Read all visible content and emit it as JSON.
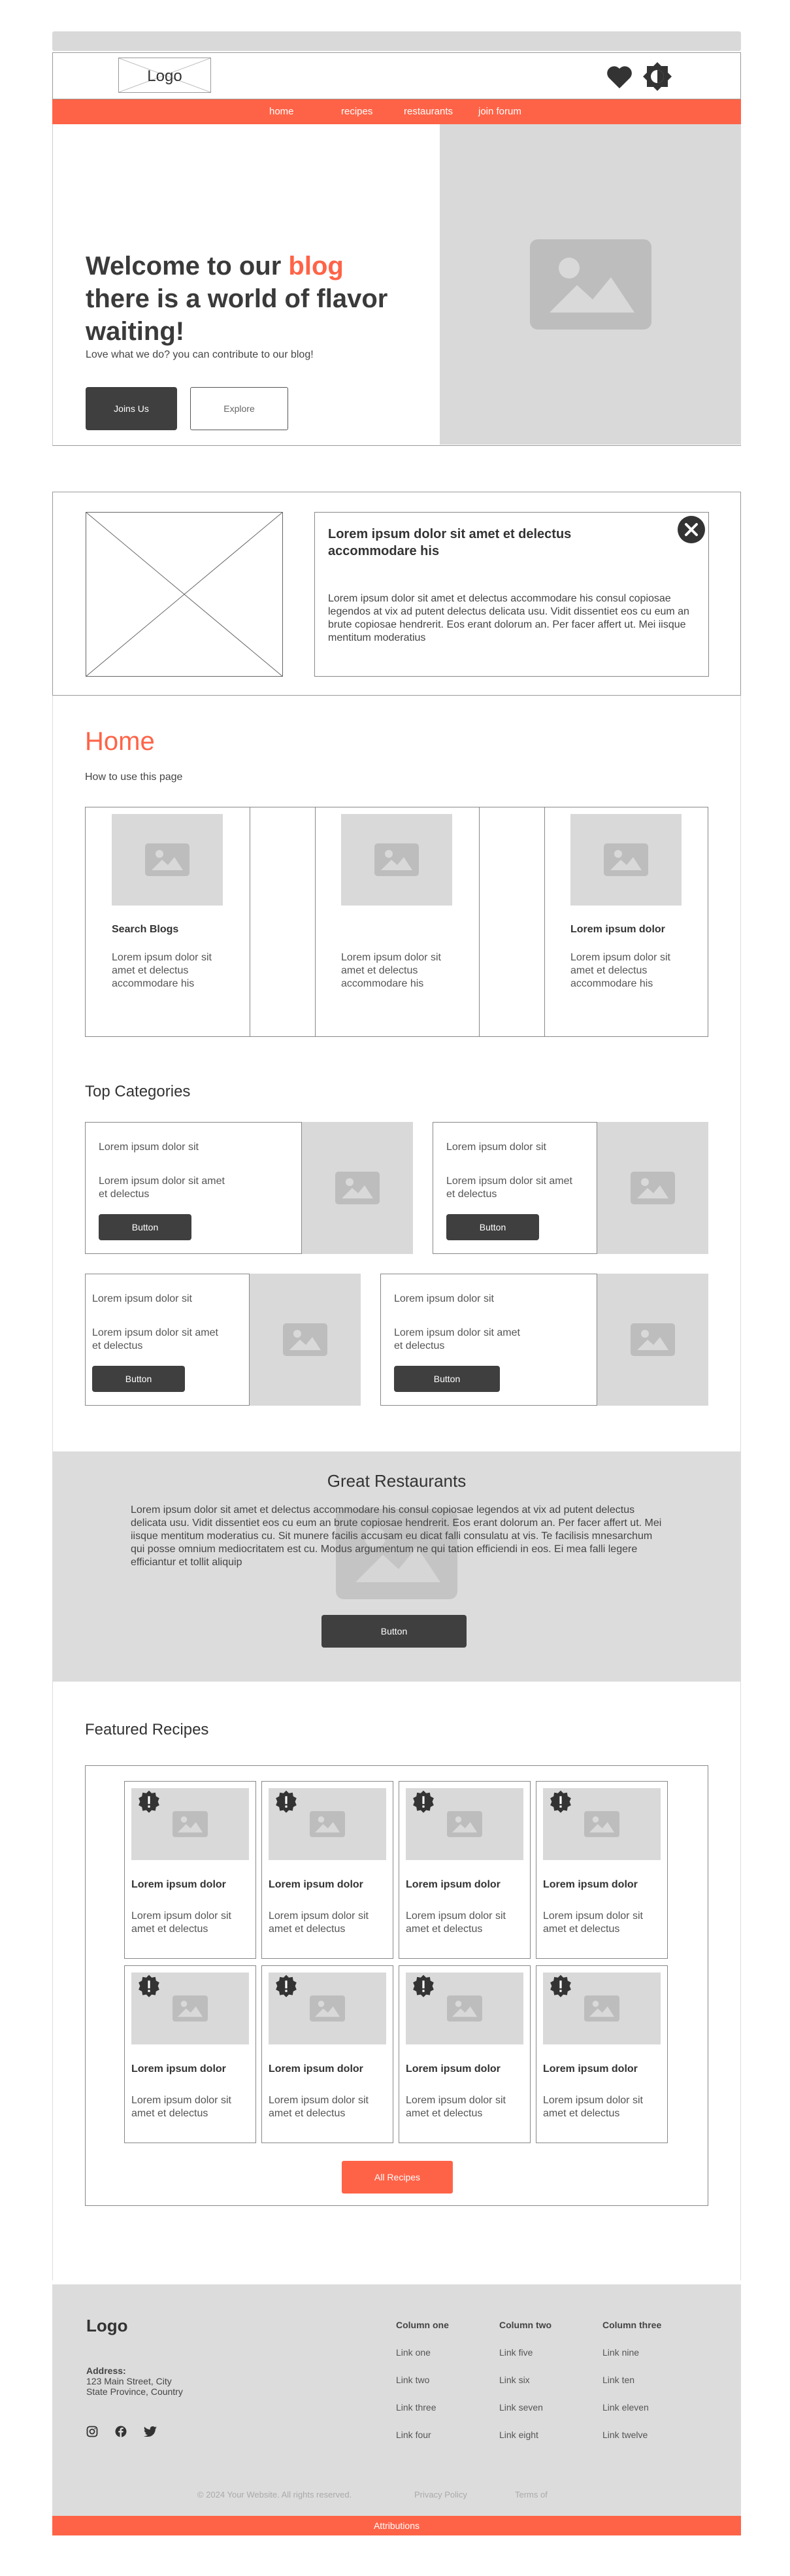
{
  "header": {
    "logo": "Logo",
    "icons": [
      "heart-icon",
      "brightness-icon"
    ]
  },
  "nav": {
    "items": [
      "home",
      "recipes",
      "restaurants",
      "join forum"
    ]
  },
  "hero": {
    "title_part1": "Welcome to our ",
    "title_accent": "blog",
    "title_part2": "there is a world of flavor waiting!",
    "subtitle": "Love what we do? you can contribute to our blog!",
    "primary_button": "Joins Us",
    "secondary_button": "Explore"
  },
  "notice": {
    "title": "Lorem ipsum dolor sit amet et delectus accommodare his",
    "text": "Lorem ipsum dolor sit amet et delectus accommodare his consul copiosae legendos at vix ad putent delectus delicata usu. Vidit dissentiet eos cu eum an brute copiosae hendrerit. Eos erant dolorum an. Per facer affert ut. Mei iisque mentitum moderatius"
  },
  "home": {
    "title": "Home",
    "subtitle": "How to use this page",
    "cards": [
      {
        "title": "Search Blogs",
        "text": "Lorem ipsum dolor sit amet et delectus accommodare his"
      },
      {
        "title": "",
        "text": "Lorem ipsum dolor sit amet et delectus accommodare his"
      },
      {
        "title": "Lorem ipsum dolor",
        "text": "Lorem ipsum dolor sit amet et delectus accommodare his"
      }
    ]
  },
  "categories": {
    "title": "Top Categories",
    "items": [
      {
        "title": "Lorem ipsum dolor sit",
        "text": "Lorem ipsum dolor sit amet et delectus",
        "button": "Button"
      },
      {
        "title": "Lorem ipsum dolor sit",
        "text": "Lorem ipsum dolor sit amet et delectus",
        "button": "Button"
      },
      {
        "title": "Lorem ipsum dolor sit",
        "text": "Lorem ipsum dolor sit amet et delectus",
        "button": "Button"
      },
      {
        "title": "Lorem ipsum dolor sit",
        "text": "Lorem ipsum dolor sit amet et delectus",
        "button": "Button"
      }
    ]
  },
  "restaurants": {
    "title": "Great Restaurants",
    "text": "Lorem ipsum dolor sit amet et delectus accommodare his consul copiosae legendos at vix ad putent delectus delicata usu. Vidit dissentiet eos cu eum an brute copiosae hendrerit. Eos erant dolorum an. Per facer affert ut. Mei iisque mentitum moderatius cu. Sit munere facilis accusam eu dicat falli consulatu at vis. Te facilisis mnesarchum qui posse omnium mediocritatem est cu. Modus argumentum ne qui tation efficiendi in eos. Ei mea falli legere efficiantur et tollit aliquip",
    "button": "Button"
  },
  "recipes": {
    "title": "Featured Recipes",
    "items": [
      {
        "title": "Lorem ipsum dolor",
        "text": "Lorem ipsum dolor sit amet et delectus"
      },
      {
        "title": "Lorem ipsum dolor",
        "text": "Lorem ipsum dolor sit amet et delectus"
      },
      {
        "title": "Lorem ipsum dolor",
        "text": "Lorem ipsum dolor sit amet et delectus"
      },
      {
        "title": "Lorem ipsum dolor",
        "text": "Lorem ipsum dolor sit amet et delectus"
      },
      {
        "title": "Lorem ipsum dolor",
        "text": "Lorem ipsum dolor sit amet et delectus"
      },
      {
        "title": "Lorem ipsum dolor",
        "text": "Lorem ipsum dolor sit amet et delectus"
      },
      {
        "title": "Lorem ipsum dolor",
        "text": "Lorem ipsum dolor sit amet et delectus"
      },
      {
        "title": "Lorem ipsum dolor",
        "text": "Lorem ipsum dolor sit amet et delectus"
      }
    ],
    "button": "All Recipes"
  },
  "footer": {
    "logo": "Logo",
    "address_label": "Address:",
    "address_line1": "123 Main Street, City",
    "address_line2": "State Province, Country",
    "social": [
      "instagram-icon",
      "facebook-icon",
      "twitter-icon"
    ],
    "columns": [
      {
        "title": "Column one",
        "links": [
          "Link one",
          "Link two",
          "Link three",
          "Link four"
        ]
      },
      {
        "title": "Column two",
        "links": [
          "Link five",
          "Link six",
          "Link seven",
          "Link eight"
        ]
      },
      {
        "title": "Column three",
        "links": [
          "Link nine",
          "Link ten",
          "Link eleven",
          "Link twelve"
        ]
      }
    ],
    "copyright": "© 2024 Your Website. All rights reserved.",
    "privacy": "Privacy Policy",
    "terms": "Terms of",
    "attributions": "Attributions"
  },
  "colors": {
    "accent": "#ff6347",
    "dark": "#3f3f3f",
    "placeholder": "#d9d9d9",
    "footer_bg": "#dcdcdc"
  }
}
